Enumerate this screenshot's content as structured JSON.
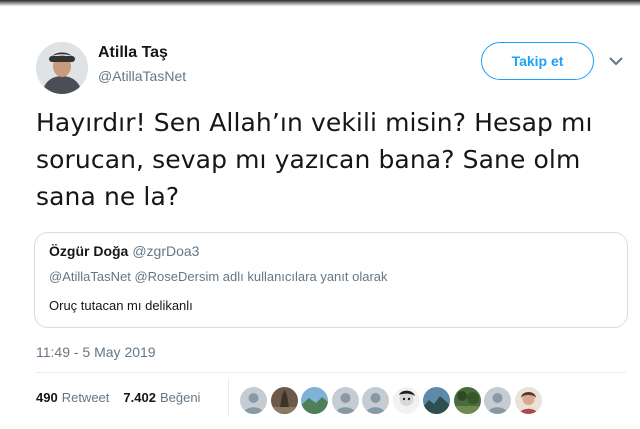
{
  "author": {
    "name": "Atilla Taş",
    "handle": "@AtillaTasNet"
  },
  "follow_button": {
    "label": "Takip et"
  },
  "tweet": {
    "text_lines": [
      "Hayırdır! Sen Allah’ın vekili misin? Hesap mı",
      "sorucan, sevap mı yazıcan bana? Sane olm",
      "sana ne la?"
    ]
  },
  "quoted_tweet": {
    "name": "Özgür Doğa",
    "handle": "@zgrDoa3",
    "reply_to": "@AtillaTasNet @RoseDersim adlı kullanıcılara yanıt olarak",
    "text": "Oruç tutacan mı delikanlı"
  },
  "timestamp": "11:49 - 5 May 2019",
  "stats": {
    "retweets": "490",
    "retweets_label": "Retweet",
    "likes": "7.402",
    "likes_label": "Beğeni"
  },
  "colors": {
    "accent": "#1da1f2",
    "text": "#14171a",
    "secondary": "#657786"
  }
}
